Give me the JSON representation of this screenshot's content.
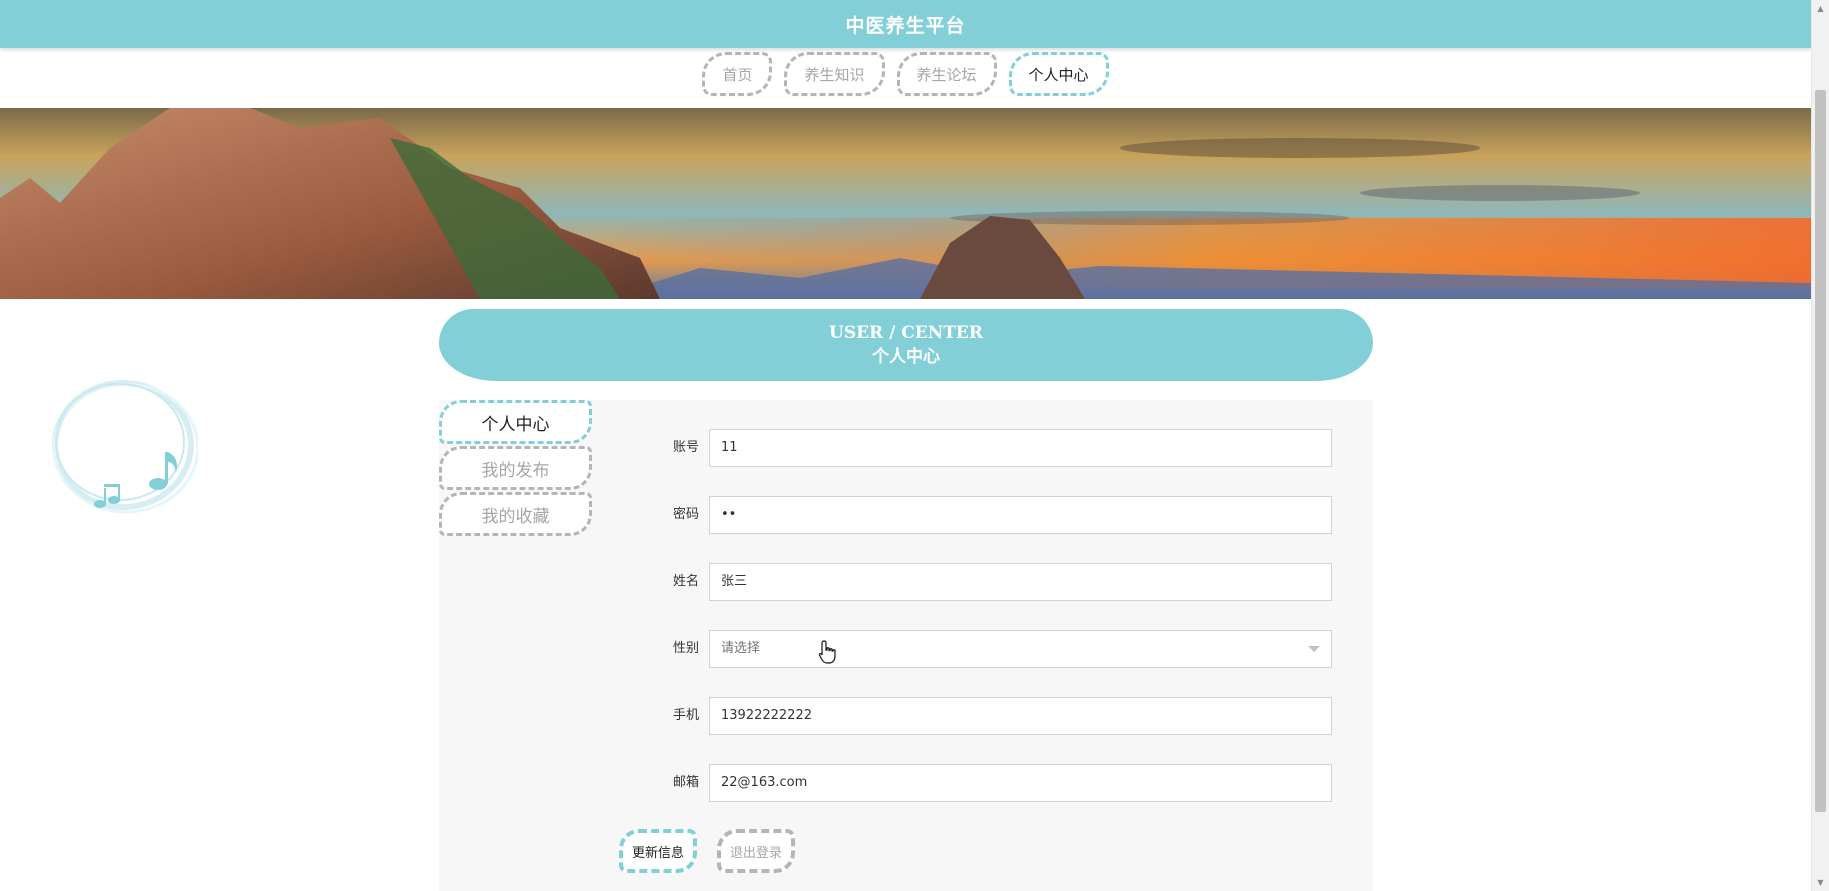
{
  "header": {
    "title": "中医养生平台"
  },
  "nav": {
    "items": [
      {
        "label": "首页",
        "active": false
      },
      {
        "label": "养生知识",
        "active": false
      },
      {
        "label": "养生论坛",
        "active": false
      },
      {
        "label": "个人中心",
        "active": true
      }
    ]
  },
  "section": {
    "title_en": "USER / CENTER",
    "title_cn": "个人中心"
  },
  "sidebar": {
    "tabs": [
      {
        "label": "个人中心",
        "active": true
      },
      {
        "label": "我的发布",
        "active": false
      },
      {
        "label": "我的收藏",
        "active": false
      }
    ]
  },
  "form": {
    "account": {
      "label": "账号",
      "value": "11"
    },
    "password": {
      "label": "密码",
      "value": "••"
    },
    "name": {
      "label": "姓名",
      "value": "张三"
    },
    "gender": {
      "label": "性别",
      "value": "请选择"
    },
    "phone": {
      "label": "手机",
      "value": "13922222222"
    },
    "email": {
      "label": "邮箱",
      "value": "22@163.com"
    }
  },
  "buttons": {
    "update": "更新信息",
    "logout": "退出登录"
  },
  "colors": {
    "accent": "#82cfd8",
    "muted_border": "#b5b5b5",
    "panel_bg": "#f7f7f7"
  },
  "icons": [
    "music-note-icon",
    "chevron-down-icon",
    "hand-pointer-icon"
  ]
}
